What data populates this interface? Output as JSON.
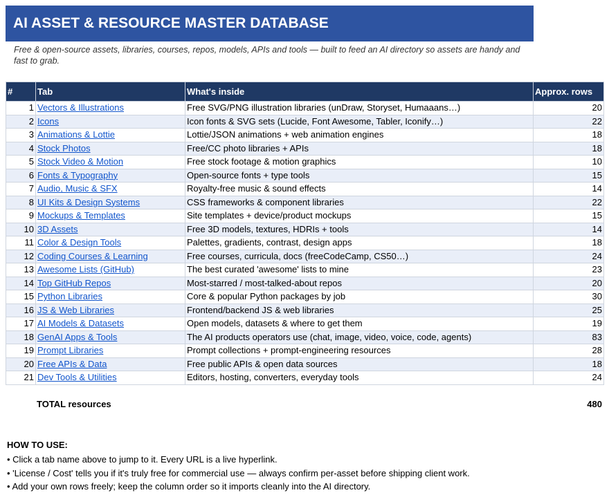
{
  "header": {
    "title": "AI ASSET & RESOURCE MASTER DATABASE",
    "subtitle": "Free & open-source assets, libraries, courses, repos, models, APIs and tools — built to feed an AI directory so assets are handy and fast to grab."
  },
  "table": {
    "headers": [
      "#",
      "Tab",
      "What's inside",
      "Approx. rows"
    ],
    "rows": [
      {
        "num": "1",
        "tab": "Vectors & Illustrations",
        "desc": "Free SVG/PNG illustration libraries (unDraw, Storyset, Humaaans…)",
        "count": "20"
      },
      {
        "num": "2",
        "tab": "Icons",
        "desc": "Icon fonts & SVG sets (Lucide, Font Awesome, Tabler, Iconify…)",
        "count": "22"
      },
      {
        "num": "3",
        "tab": "Animations & Lottie",
        "desc": "Lottie/JSON animations + web animation engines",
        "count": "18"
      },
      {
        "num": "4",
        "tab": "Stock Photos",
        "desc": "Free/CC photo libraries + APIs",
        "count": "18"
      },
      {
        "num": "5",
        "tab": "Stock Video & Motion",
        "desc": "Free stock footage & motion graphics",
        "count": "10"
      },
      {
        "num": "6",
        "tab": "Fonts & Typography",
        "desc": "Open-source fonts + type tools",
        "count": "15"
      },
      {
        "num": "7",
        "tab": "Audio, Music & SFX",
        "desc": "Royalty-free music & sound effects",
        "count": "14"
      },
      {
        "num": "8",
        "tab": "UI Kits & Design Systems",
        "desc": "CSS frameworks & component libraries",
        "count": "22"
      },
      {
        "num": "9",
        "tab": "Mockups & Templates",
        "desc": "Site templates + device/product mockups",
        "count": "15"
      },
      {
        "num": "10",
        "tab": "3D Assets",
        "desc": "Free 3D models, textures, HDRIs + tools",
        "count": "14"
      },
      {
        "num": "11",
        "tab": "Color & Design Tools",
        "desc": "Palettes, gradients, contrast, design apps",
        "count": "18"
      },
      {
        "num": "12",
        "tab": "Coding Courses & Learning",
        "desc": "Free courses, curricula, docs (freeCodeCamp, CS50…)",
        "count": "24"
      },
      {
        "num": "13",
        "tab": "Awesome Lists (GitHub)",
        "desc": "The best curated 'awesome' lists to mine",
        "count": "23"
      },
      {
        "num": "14",
        "tab": "Top GitHub Repos",
        "desc": "Most-starred / most-talked-about repos",
        "count": "20"
      },
      {
        "num": "15",
        "tab": "Python Libraries",
        "desc": "Core & popular Python packages by job",
        "count": "30"
      },
      {
        "num": "16",
        "tab": "JS & Web Libraries",
        "desc": "Frontend/backend JS & web libraries",
        "count": "25"
      },
      {
        "num": "17",
        "tab": "AI Models & Datasets",
        "desc": "Open models, datasets & where to get them",
        "count": "19"
      },
      {
        "num": "18",
        "tab": "GenAI Apps & Tools",
        "desc": "The AI products operators use (chat, image, video, voice, code, agents)",
        "count": "83"
      },
      {
        "num": "19",
        "tab": "Prompt Libraries",
        "desc": "Prompt collections + prompt-engineering resources",
        "count": "28"
      },
      {
        "num": "20",
        "tab": "Free APIs & Data",
        "desc": "Free public APIs & open data sources",
        "count": "18"
      },
      {
        "num": "21",
        "tab": "Dev Tools & Utilities",
        "desc": "Editors, hosting, converters, everyday tools",
        "count": "24"
      }
    ]
  },
  "total": {
    "label": "TOTAL resources",
    "value": "480"
  },
  "howto": {
    "title": "HOW TO USE:",
    "items": [
      "• Click a tab name above to jump to it. Every URL is a live hyperlink.",
      "• 'License / Cost' tells you if it's truly free for commercial use — always confirm per-asset before shipping client work.",
      "• Add your own rows freely; keep the column order so it imports cleanly into the AI directory."
    ]
  },
  "colors": {
    "banner": "#2e54a1",
    "table_header": "#1f3964",
    "alt_row": "#e9eef8",
    "link": "#1155cc"
  }
}
